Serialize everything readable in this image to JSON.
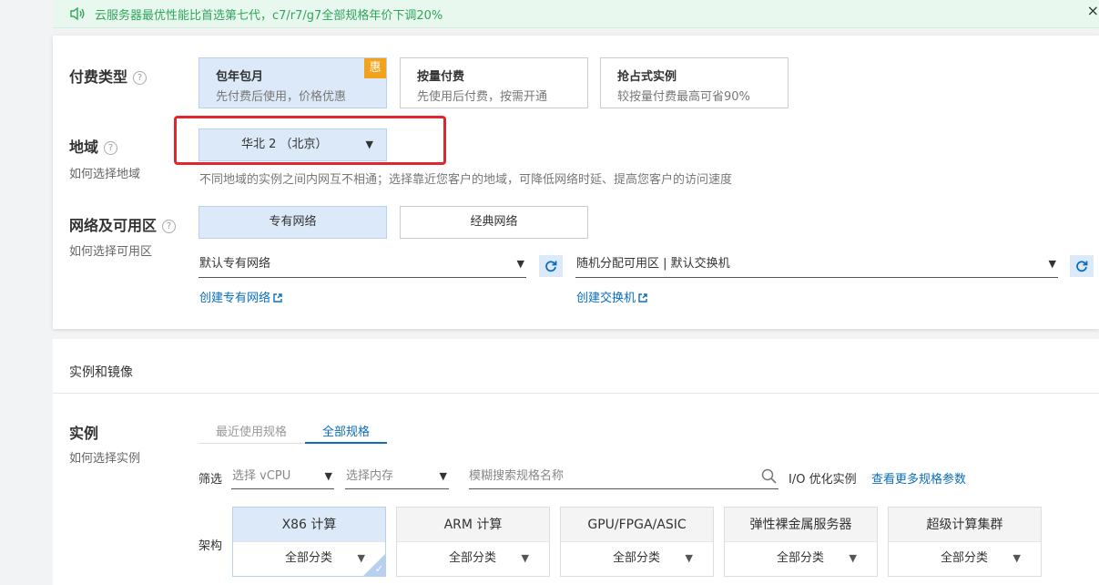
{
  "notice": {
    "text": "云服务器最优性能比首选第七代，c7/r7/g7全部规格年价下调20%",
    "close": "×"
  },
  "payment": {
    "label": "付费类型",
    "help": "?",
    "options": [
      {
        "title": "包年包月",
        "desc": "先付费后使用，价格优惠",
        "badge": "惠"
      },
      {
        "title": "按量付费",
        "desc": "先使用后付费，按需开通"
      },
      {
        "title": "抢占式实例",
        "desc": "较按量付费最高可省90%"
      }
    ]
  },
  "region": {
    "label": "地域",
    "help": "?",
    "sub": "如何选择地域",
    "selected": "华北 2 （北京）",
    "hint": "不同地域的实例之间内网互不相通；选择靠近您客户的地域，可降低网络时延、提高您客户的访问速度"
  },
  "network": {
    "label": "网络及可用区",
    "help": "?",
    "sub": "如何选择可用区",
    "types": [
      "专有网络",
      "经典网络"
    ],
    "vpc_select": "默认专有网络",
    "zone_select": "随机分配可用区 | 默认交换机",
    "create_vpc_link": "创建专有网络",
    "create_switch_link": "创建交换机"
  },
  "instance_section": {
    "title": "实例和镜像"
  },
  "instance": {
    "label": "实例",
    "sub": "如何选择实例",
    "tabs": [
      "最近使用规格",
      "全部规格"
    ],
    "filter_label": "筛选",
    "vcpu_placeholder": "选择 vCPU",
    "memory_placeholder": "选择内存",
    "search_placeholder": "模糊搜索规格名称",
    "io_label": "I/O 优化实例",
    "more_link": "查看更多规格参数",
    "arch_label": "架构",
    "archs": [
      {
        "name": "X86 计算",
        "sub": "全部分类"
      },
      {
        "name": "ARM 计算",
        "sub": "全部分类"
      },
      {
        "name": "GPU/FPGA/ASIC",
        "sub": "全部分类"
      },
      {
        "name": "弹性裸金属服务器",
        "sub": "全部分类"
      },
      {
        "name": "超级计算集群",
        "sub": "全部分类"
      }
    ]
  },
  "colors": {
    "accent": "#0a6ebd",
    "selected_bg": "#dbe9f8",
    "highlight": "#e2262d",
    "badge": "#f3a31b",
    "notice_green": "#2fa55a"
  }
}
